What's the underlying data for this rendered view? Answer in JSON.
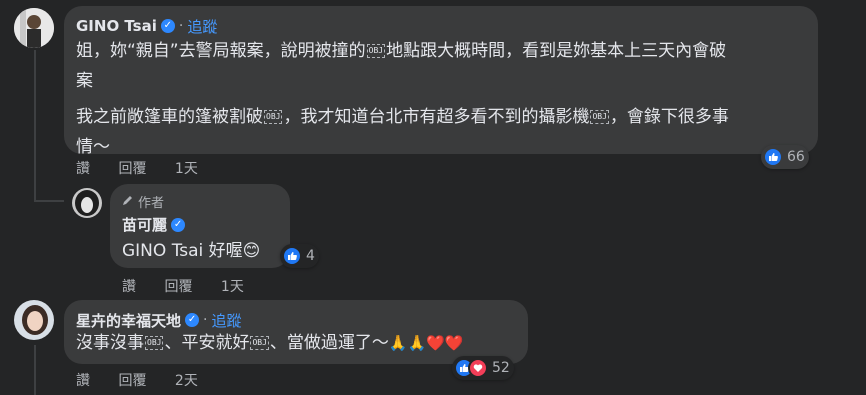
{
  "comment1": {
    "author": "GINO Tsai",
    "separator": "·",
    "follow_label": "追蹤",
    "line1": "姐，妳“親自”去警局報案，說明被撞的",
    "obj1": "OBJ",
    "line1b": "地點跟大概時間，看到是妳基本上三天內會破",
    "line2": "案",
    "line3a": "我之前敞篷車的篷被割破",
    "obj2": "OBJ",
    "line3b": "，我才知道台北市有超多看不到的攝影機",
    "obj3": "OBJ",
    "line3c": "，會錄下很多事",
    "line4": "情～",
    "actions": {
      "like": "讚",
      "reply": "回覆",
      "time": "1天"
    },
    "reaction_count": "66"
  },
  "reply1": {
    "author_tag": "作者",
    "author": "苗可麗",
    "text": "GINO Tsai 好喔",
    "emoji": "😊",
    "actions": {
      "like": "讚",
      "reply": "回覆",
      "time": "1天"
    },
    "reaction_count": "4"
  },
  "comment2": {
    "author": "星卉的幸福天地",
    "separator": "·",
    "follow_label": "追蹤",
    "text_a": "沒事沒事",
    "obj1": "OBJ",
    "text_b": "、平安就好",
    "obj2": "OBJ",
    "text_c": "、當做過運了～",
    "emojis": "🙏🙏❤️❤️",
    "actions": {
      "like": "讚",
      "reply": "回覆",
      "time": "2天"
    },
    "reaction_count": "52"
  },
  "colors": {
    "background": "#242526",
    "bubble": "#3a3b3c",
    "link": "#4599ff",
    "like": "#2078f4",
    "love": "#f33e58"
  }
}
